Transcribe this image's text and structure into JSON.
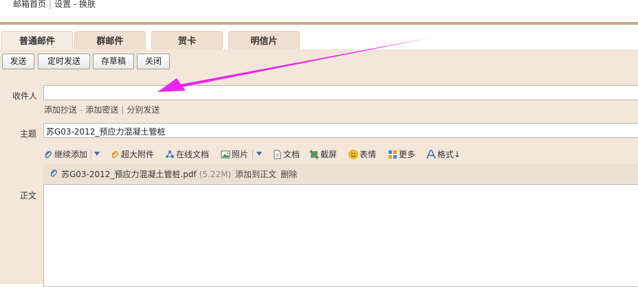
{
  "breadcrumb": {
    "home": "邮箱首页",
    "path": "设置 - 换肤"
  },
  "tabs": [
    {
      "label": "普通邮件"
    },
    {
      "label": "群邮件"
    },
    {
      "label": "贺卡"
    },
    {
      "label": "明信片"
    }
  ],
  "toolbar": {
    "send": "发送",
    "scheduled": "定时发送",
    "draft": "存草稿",
    "close": "关闭"
  },
  "recipient": {
    "label": "收件人",
    "value": ""
  },
  "recipient_links": {
    "cc": "添加抄送",
    "bcc": "添加密送",
    "separate": "分别发送"
  },
  "subject": {
    "label": "主题",
    "value": "苏G03-2012_预应力混凝土管桩"
  },
  "tools": {
    "continue_add": "继续添加",
    "large_attach": "超大附件",
    "online_doc": "在线文档",
    "photo": "照片",
    "document": "文档",
    "screenshot": "截屏",
    "emoji": "表情",
    "more": "更多",
    "format": "格式↓"
  },
  "attachment": {
    "name": "苏G03-2012_预应力混凝土管桩.pdf",
    "size": "(5.22M)",
    "add_to_body": "添加到正文",
    "delete": "删除"
  },
  "body": {
    "label": "正文"
  },
  "colors": {
    "accent": "#c9a886",
    "compose_bg": "#f3e7da",
    "annotation_arrow": "#ee22ee"
  },
  "icons": [
    "paperclip-icon",
    "online-doc-icon",
    "photo-icon",
    "document-icon",
    "screenshot-icon",
    "emoji-icon",
    "more-icon",
    "format-icon",
    "chevron-down-icon",
    "annotation-arrow"
  ]
}
